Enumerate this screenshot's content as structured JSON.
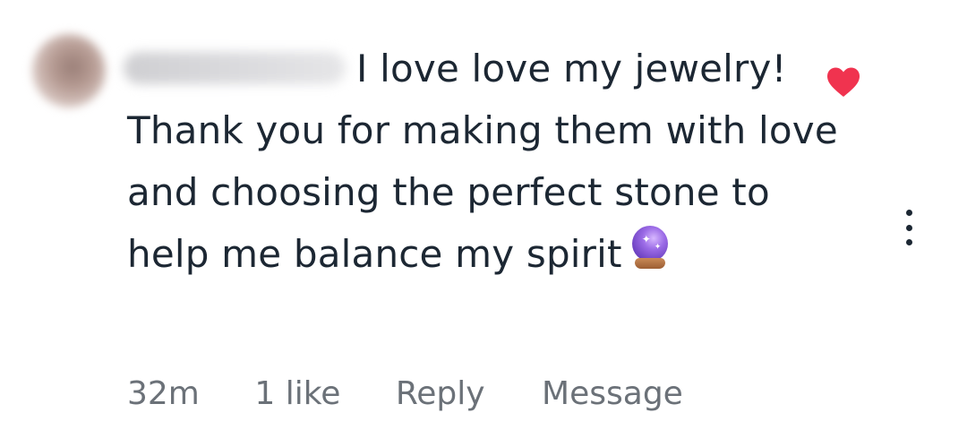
{
  "comment": {
    "username": "mjmelgar3",
    "text": "I love love my jewelry! Thank you for making them with love and choosing the perfect stone to help me balance my spirit",
    "emoji_icon": "crystal-ball-emoji"
  },
  "meta": {
    "time": "32m",
    "likes": "1 like",
    "reply_label": "Reply",
    "message_label": "Message"
  },
  "icons": {
    "like": "heart-icon",
    "more": "more-options-icon"
  },
  "colors": {
    "heart": "#f0334f",
    "text": "#1c2733",
    "secondary": "#6b7178"
  }
}
